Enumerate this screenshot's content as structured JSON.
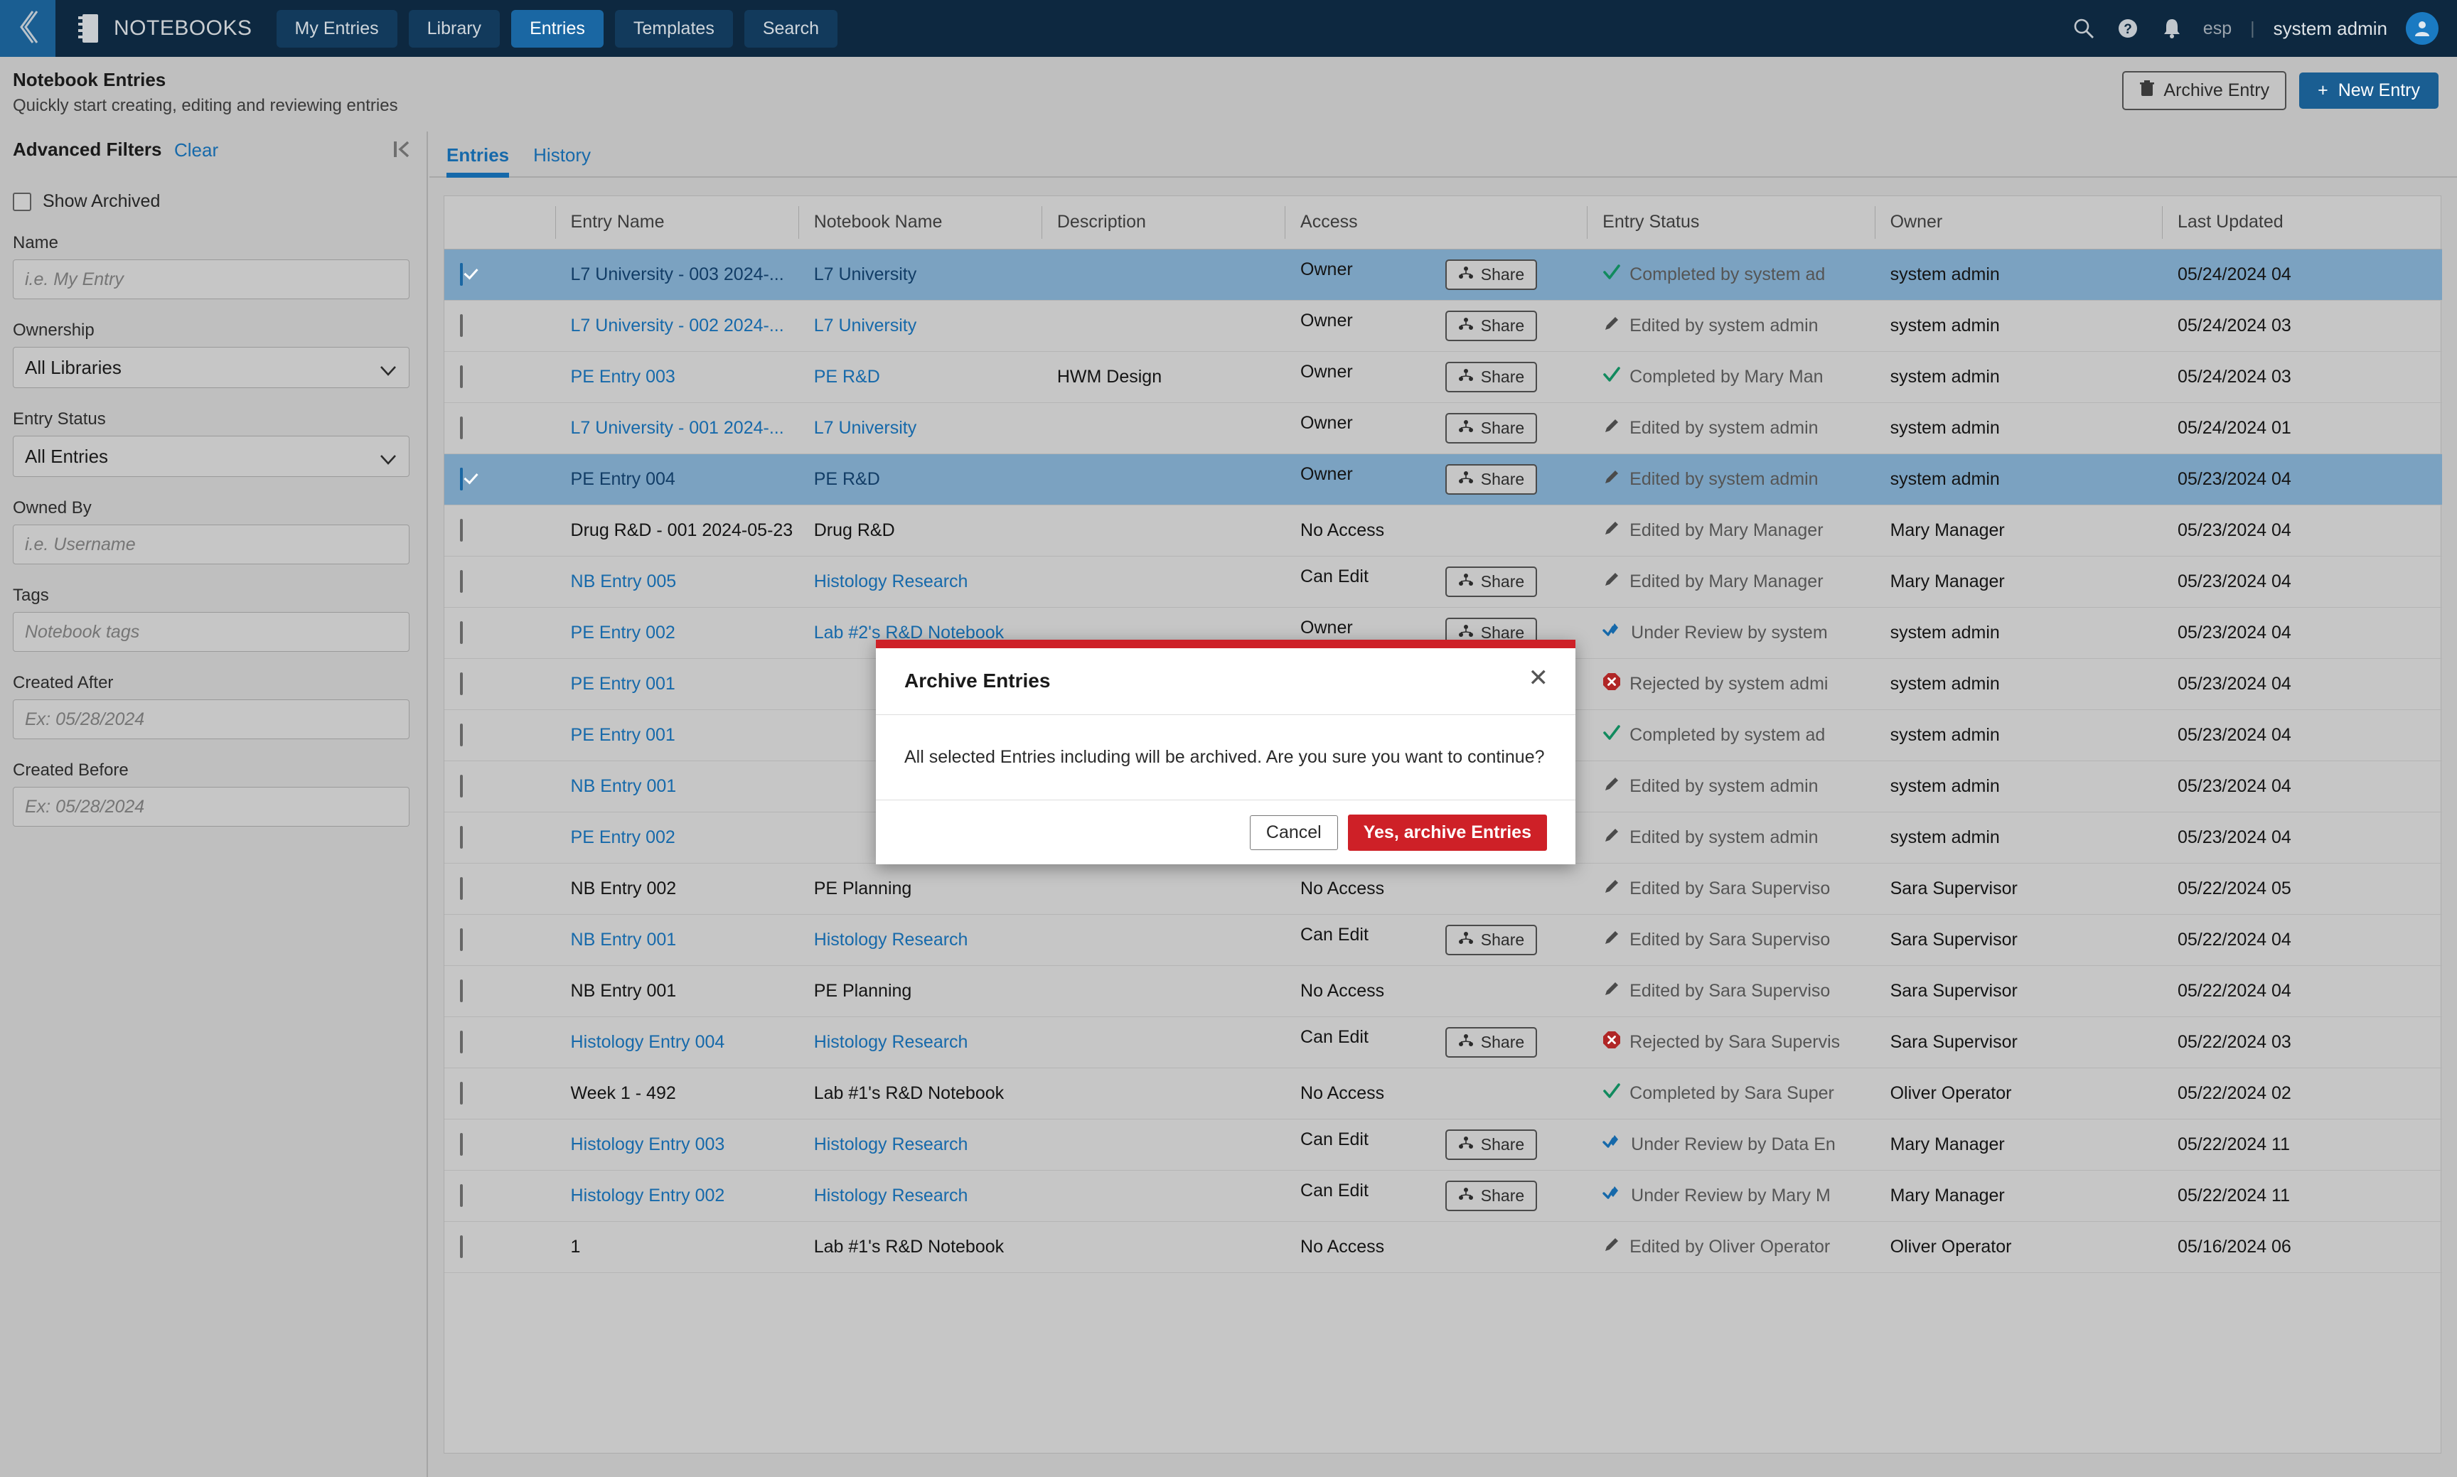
{
  "topnav": {
    "brand": "NOTEBOOKS",
    "back_icon": "chevron-left-icon",
    "tabs": [
      {
        "label": "My Entries",
        "active": false
      },
      {
        "label": "Library",
        "active": false
      },
      {
        "label": "Entries",
        "active": true
      },
      {
        "label": "Templates",
        "active": false
      },
      {
        "label": "Search",
        "active": false
      }
    ],
    "icons": [
      "search-icon",
      "help-icon",
      "notifications-icon"
    ],
    "language": "esp",
    "divider": "|",
    "user": "system admin",
    "accent": "#1a67a3",
    "background": "#0d2840"
  },
  "pagehead": {
    "title": "Notebook Entries",
    "subtitle": "Quickly start creating, editing and reviewing entries",
    "archive_label": "Archive Entry",
    "new_label": "New Entry",
    "new_plus": "+"
  },
  "sidebar": {
    "title": "Advanced Filters",
    "clear_label": "Clear",
    "collapse_icon": "collapse-panel-icon",
    "show_archived_label": "Show Archived",
    "show_archived_checked": false,
    "fields": [
      {
        "label": "Name",
        "type": "text",
        "placeholder": "i.e. My Entry",
        "value": ""
      },
      {
        "label": "Ownership",
        "type": "select",
        "value": "All Libraries"
      },
      {
        "label": "Entry Status",
        "type": "select",
        "value": "All Entries"
      },
      {
        "label": "Owned By",
        "type": "text",
        "placeholder": "i.e. Username",
        "value": ""
      },
      {
        "label": "Tags",
        "type": "text",
        "placeholder": "Notebook tags",
        "value": ""
      },
      {
        "label": "Created After",
        "type": "text",
        "placeholder": "Ex: 05/28/2024",
        "value": ""
      },
      {
        "label": "Created Before",
        "type": "text",
        "placeholder": "Ex: 05/28/2024",
        "value": ""
      }
    ]
  },
  "main": {
    "tabs": [
      {
        "label": "Entries",
        "active": true
      },
      {
        "label": "History",
        "active": false
      }
    ],
    "columns": [
      "",
      "Entry Name",
      "Notebook Name",
      "Description",
      "Access",
      "Entry Status",
      "Owner",
      "Last Updated"
    ],
    "share_label": "Share",
    "rows": [
      {
        "selected": true,
        "name": "L7 University - 003 2024-...",
        "name_link": true,
        "notebook": "L7 University",
        "notebook_link": true,
        "description": "",
        "access": "Owner",
        "share": true,
        "status": "Completed by system ad",
        "status_icon": "check-icon",
        "owner": "system admin",
        "updated": "05/24/2024 04"
      },
      {
        "selected": false,
        "name": "L7 University - 002 2024-...",
        "name_link": true,
        "notebook": "L7 University",
        "notebook_link": true,
        "description": "",
        "access": "Owner",
        "share": true,
        "status": "Edited by system admin",
        "status_icon": "pencil-icon",
        "owner": "system admin",
        "updated": "05/24/2024 03"
      },
      {
        "selected": false,
        "name": "PE Entry 003",
        "name_link": true,
        "notebook": "PE R&D",
        "notebook_link": true,
        "description": "HWM Design",
        "access": "Owner",
        "share": true,
        "status": "Completed by Mary Man",
        "status_icon": "check-icon",
        "owner": "system admin",
        "updated": "05/24/2024 03"
      },
      {
        "selected": false,
        "name": "L7 University - 001 2024-...",
        "name_link": true,
        "notebook": "L7 University",
        "notebook_link": true,
        "description": "",
        "access": "Owner",
        "share": true,
        "status": "Edited by system admin",
        "status_icon": "pencil-icon",
        "owner": "system admin",
        "updated": "05/24/2024 01"
      },
      {
        "selected": true,
        "name": "PE Entry 004",
        "name_link": true,
        "notebook": "PE R&D",
        "notebook_link": true,
        "description": "",
        "access": "Owner",
        "share": true,
        "status": "Edited by system admin",
        "status_icon": "pencil-icon",
        "owner": "system admin",
        "updated": "05/23/2024 04"
      },
      {
        "selected": false,
        "name": "Drug R&D - 001 2024-05-23",
        "name_link": false,
        "notebook": "Drug R&D",
        "notebook_link": false,
        "description": "",
        "access": "No Access",
        "share": false,
        "status": "Edited by Mary Manager",
        "status_icon": "pencil-icon",
        "owner": "Mary Manager",
        "updated": "05/23/2024 04"
      },
      {
        "selected": false,
        "name": "NB Entry 005",
        "name_link": true,
        "notebook": "Histology Research",
        "notebook_link": true,
        "description": "",
        "access": "Can Edit",
        "share": true,
        "status": "Edited by Mary Manager",
        "status_icon": "pencil-icon",
        "owner": "Mary Manager",
        "updated": "05/23/2024 04"
      },
      {
        "selected": false,
        "name": "PE Entry 002",
        "name_link": true,
        "notebook": "Lab #2's R&D Notebook",
        "notebook_link": true,
        "description": "",
        "access": "Owner",
        "share": true,
        "status": "Under Review by system",
        "status_icon": "review-icon",
        "owner": "system admin",
        "updated": "05/23/2024 04"
      },
      {
        "selected": false,
        "name": "PE Entry 001",
        "name_link": true,
        "notebook": "",
        "notebook_link": true,
        "description": "",
        "access": "",
        "share": true,
        "status": "Rejected by system admi",
        "status_icon": "reject-icon",
        "owner": "system admin",
        "updated": "05/23/2024 04"
      },
      {
        "selected": false,
        "name": "PE Entry 001",
        "name_link": true,
        "notebook": "",
        "notebook_link": true,
        "description": "",
        "access": "",
        "share": true,
        "status": "Completed by system ad",
        "status_icon": "check-icon",
        "owner": "system admin",
        "updated": "05/23/2024 04"
      },
      {
        "selected": false,
        "name": "NB Entry 001",
        "name_link": true,
        "notebook": "",
        "notebook_link": true,
        "description": "",
        "access": "",
        "share": true,
        "status": "Edited by system admin",
        "status_icon": "pencil-icon",
        "owner": "system admin",
        "updated": "05/23/2024 04"
      },
      {
        "selected": false,
        "name": "PE Entry 002",
        "name_link": true,
        "notebook": "",
        "notebook_link": true,
        "description": "",
        "access": "",
        "share": true,
        "status": "Edited by system admin",
        "status_icon": "pencil-icon",
        "owner": "system admin",
        "updated": "05/23/2024 04"
      },
      {
        "selected": false,
        "name": "NB Entry 002",
        "name_link": false,
        "notebook": "PE Planning",
        "notebook_link": false,
        "description": "",
        "access": "No Access",
        "share": false,
        "status": "Edited by Sara Superviso",
        "status_icon": "pencil-icon",
        "owner": "Sara Supervisor",
        "updated": "05/22/2024 05"
      },
      {
        "selected": false,
        "name": "NB Entry 001",
        "name_link": true,
        "notebook": "Histology Research",
        "notebook_link": true,
        "description": "",
        "access": "Can Edit",
        "share": true,
        "status": "Edited by Sara Superviso",
        "status_icon": "pencil-icon",
        "owner": "Sara Supervisor",
        "updated": "05/22/2024 04"
      },
      {
        "selected": false,
        "name": "NB Entry 001",
        "name_link": false,
        "notebook": "PE Planning",
        "notebook_link": false,
        "description": "",
        "access": "No Access",
        "share": false,
        "status": "Edited by Sara Superviso",
        "status_icon": "pencil-icon",
        "owner": "Sara Supervisor",
        "updated": "05/22/2024 04"
      },
      {
        "selected": false,
        "name": "Histology Entry 004",
        "name_link": true,
        "notebook": "Histology Research",
        "notebook_link": true,
        "description": "",
        "access": "Can Edit",
        "share": true,
        "status": "Rejected by Sara Supervis",
        "status_icon": "reject-icon",
        "owner": "Sara Supervisor",
        "updated": "05/22/2024 03"
      },
      {
        "selected": false,
        "name": "Week 1 - 492",
        "name_link": false,
        "notebook": "Lab #1's R&D Notebook",
        "notebook_link": false,
        "description": "",
        "access": "No Access",
        "share": false,
        "status": "Completed by Sara Super",
        "status_icon": "check-icon",
        "owner": "Oliver Operator",
        "updated": "05/22/2024 02"
      },
      {
        "selected": false,
        "name": "Histology Entry 003",
        "name_link": true,
        "notebook": "Histology Research",
        "notebook_link": true,
        "description": "",
        "access": "Can Edit",
        "share": true,
        "status": "Under Review by Data En",
        "status_icon": "review-icon",
        "owner": "Mary Manager",
        "updated": "05/22/2024 11"
      },
      {
        "selected": false,
        "name": "Histology Entry 002",
        "name_link": true,
        "notebook": "Histology Research",
        "notebook_link": true,
        "description": "",
        "access": "Can Edit",
        "share": true,
        "status": "Under Review by Mary M",
        "status_icon": "review-icon",
        "owner": "Mary Manager",
        "updated": "05/22/2024 11"
      },
      {
        "selected": false,
        "name": "1",
        "name_link": false,
        "notebook": "Lab #1's R&D Notebook",
        "notebook_link": false,
        "description": "",
        "access": "No Access",
        "share": false,
        "status": "Edited by Oliver Operator",
        "status_icon": "pencil-icon",
        "owner": "Oliver Operator",
        "updated": "05/16/2024 06"
      }
    ]
  },
  "modal": {
    "title": "Archive Entries",
    "close_icon": "close-icon",
    "message": "All selected Entries including will be archived. Are you sure you want to continue?",
    "cancel_label": "Cancel",
    "confirm_label": "Yes, archive Entries",
    "accent": "#ce2027"
  }
}
